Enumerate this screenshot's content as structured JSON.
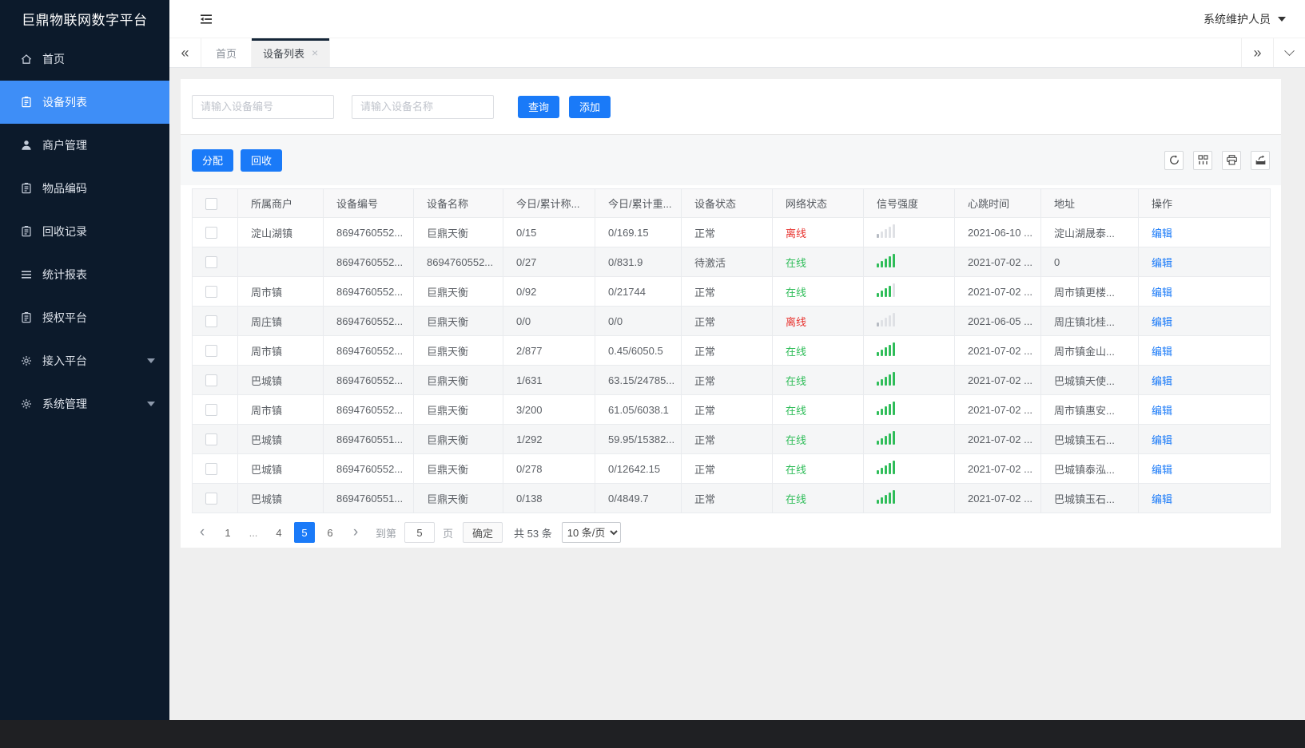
{
  "colors": {
    "primary_blue": "#1a7af8",
    "sidebar_bg": "#0c1a2b",
    "sidebar_active": "#3e8ef7",
    "online_green": "#2fbd59",
    "offline_red": "#e8322e",
    "link_blue": "#1a7af8"
  },
  "app": {
    "logo_title": "巨鼎物联网数字平台",
    "user_name": "系统维护人员"
  },
  "sidebar": {
    "items": [
      {
        "label": "首页",
        "icon": "home-icon",
        "active": false,
        "caret": false
      },
      {
        "label": "设备列表",
        "icon": "clipboard-icon",
        "active": true,
        "caret": false
      },
      {
        "label": "商户管理",
        "icon": "user-icon",
        "active": false,
        "caret": false
      },
      {
        "label": "物品编码",
        "icon": "clipboard-icon",
        "active": false,
        "caret": false
      },
      {
        "label": "回收记录",
        "icon": "clipboard-icon",
        "active": false,
        "caret": false
      },
      {
        "label": "统计报表",
        "icon": "list-icon",
        "active": false,
        "caret": false
      },
      {
        "label": "授权平台",
        "icon": "clipboard-icon",
        "active": false,
        "caret": false
      },
      {
        "label": "接入平台",
        "icon": "gear-icon",
        "active": false,
        "caret": true
      },
      {
        "label": "系统管理",
        "icon": "gear-icon",
        "active": false,
        "caret": true
      }
    ]
  },
  "glyphs": {
    "scroll_left": "«",
    "scroll_right": "»",
    "tab_close": "×"
  },
  "tabs": [
    {
      "label": "首页",
      "active": false,
      "closable": false
    },
    {
      "label": "设备列表",
      "active": true,
      "closable": true
    }
  ],
  "search": {
    "device_no_placeholder": "请输入设备编号",
    "device_name_placeholder": "请输入设备名称",
    "query_label": "查询",
    "add_label": "添加"
  },
  "toolbar": {
    "assign_label": "分配",
    "recycle_label": "回收",
    "icon_buttons": [
      "refresh-icon",
      "columns-icon",
      "print-icon",
      "export-icon"
    ]
  },
  "table": {
    "columns": [
      "所属商户",
      "设备编号",
      "设备名称",
      "今日/累计称...",
      "今日/累计重...",
      "设备状态",
      "网络状态",
      "信号强度",
      "心跳时间",
      "地址",
      "操作"
    ],
    "edit_label": "编辑",
    "rows": [
      {
        "merchant": "淀山湖镇",
        "device_no": "8694760552...",
        "device_name": "巨鼎天衡",
        "today_count": "0/15",
        "today_weight": "0/169.15",
        "device_status": "正常",
        "network": "离线",
        "online": false,
        "signal": 1,
        "heartbeat": "2021-06-10 ...",
        "address": "淀山湖晟泰..."
      },
      {
        "merchant": "",
        "device_no": "8694760552...",
        "device_name": "8694760552...",
        "today_count": "0/27",
        "today_weight": "0/831.9",
        "device_status": "待激活",
        "network": "在线",
        "online": true,
        "signal": 5,
        "heartbeat": "2021-07-02 ...",
        "address": "0"
      },
      {
        "merchant": "周市镇",
        "device_no": "8694760552...",
        "device_name": "巨鼎天衡",
        "today_count": "0/92",
        "today_weight": "0/21744",
        "device_status": "正常",
        "network": "在线",
        "online": true,
        "signal": 4,
        "heartbeat": "2021-07-02 ...",
        "address": "周市镇更楼..."
      },
      {
        "merchant": "周庄镇",
        "device_no": "8694760552...",
        "device_name": "巨鼎天衡",
        "today_count": "0/0",
        "today_weight": "0/0",
        "device_status": "正常",
        "network": "离线",
        "online": false,
        "signal": 1,
        "heartbeat": "2021-06-05 ...",
        "address": "周庄镇北桂..."
      },
      {
        "merchant": "周市镇",
        "device_no": "8694760552...",
        "device_name": "巨鼎天衡",
        "today_count": "2/877",
        "today_weight": "0.45/6050.5",
        "device_status": "正常",
        "network": "在线",
        "online": true,
        "signal": 5,
        "heartbeat": "2021-07-02 ...",
        "address": "周市镇金山..."
      },
      {
        "merchant": "巴城镇",
        "device_no": "8694760552...",
        "device_name": "巨鼎天衡",
        "today_count": "1/631",
        "today_weight": "63.15/24785...",
        "device_status": "正常",
        "network": "在线",
        "online": true,
        "signal": 5,
        "heartbeat": "2021-07-02 ...",
        "address": "巴城镇天使..."
      },
      {
        "merchant": "周市镇",
        "device_no": "8694760552...",
        "device_name": "巨鼎天衡",
        "today_count": "3/200",
        "today_weight": "61.05/6038.1",
        "device_status": "正常",
        "network": "在线",
        "online": true,
        "signal": 5,
        "heartbeat": "2021-07-02 ...",
        "address": "周市镇惠安..."
      },
      {
        "merchant": "巴城镇",
        "device_no": "8694760551...",
        "device_name": "巨鼎天衡",
        "today_count": "1/292",
        "today_weight": "59.95/15382...",
        "device_status": "正常",
        "network": "在线",
        "online": true,
        "signal": 5,
        "heartbeat": "2021-07-02 ...",
        "address": "巴城镇玉石..."
      },
      {
        "merchant": "巴城镇",
        "device_no": "8694760552...",
        "device_name": "巨鼎天衡",
        "today_count": "0/278",
        "today_weight": "0/12642.15",
        "device_status": "正常",
        "network": "在线",
        "online": true,
        "signal": 5,
        "heartbeat": "2021-07-02 ...",
        "address": "巴城镇泰泓..."
      },
      {
        "merchant": "巴城镇",
        "device_no": "8694760551...",
        "device_name": "巨鼎天衡",
        "today_count": "0/138",
        "today_weight": "0/4849.7",
        "device_status": "正常",
        "network": "在线",
        "online": true,
        "signal": 5,
        "heartbeat": "2021-07-02 ...",
        "address": "巴城镇玉石..."
      }
    ]
  },
  "pagination": {
    "pages": [
      {
        "label": "‹",
        "type": "prev"
      },
      {
        "label": "1",
        "type": "page"
      },
      {
        "label": "...",
        "type": "ellipsis"
      },
      {
        "label": "4",
        "type": "page"
      },
      {
        "label": "5",
        "type": "page",
        "active": true
      },
      {
        "label": "6",
        "type": "page"
      },
      {
        "label": "›",
        "type": "next"
      }
    ],
    "goto_prefix": "到第",
    "goto_value": "5",
    "goto_suffix": "页",
    "confirm_label": "确定",
    "total_text": "共 53 条",
    "page_size": "10 条/页"
  }
}
